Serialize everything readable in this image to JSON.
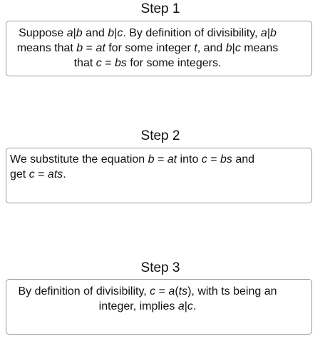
{
  "steps": [
    {
      "title": "Step 1",
      "lines": [
        [
          {
            "t": "Suppose "
          },
          {
            "t": "a",
            "i": true
          },
          {
            "t": "|"
          },
          {
            "t": "b",
            "i": true
          },
          {
            "t": " and "
          },
          {
            "t": "b",
            "i": true
          },
          {
            "t": "|"
          },
          {
            "t": "c",
            "i": true
          },
          {
            "t": ". By definition of divisibility, "
          },
          {
            "t": "a",
            "i": true
          },
          {
            "t": "|"
          },
          {
            "t": "b",
            "i": true
          }
        ],
        [
          {
            "t": "means that "
          },
          {
            "t": "b",
            "i": true
          },
          {
            "t": " = "
          },
          {
            "t": "at",
            "i": true
          },
          {
            "t": " for some integer "
          },
          {
            "t": "t",
            "i": true
          },
          {
            "t": ", and "
          },
          {
            "t": "b",
            "i": true
          },
          {
            "t": "|"
          },
          {
            "t": "c",
            "i": true
          },
          {
            "t": " means"
          }
        ],
        [
          {
            "t": "that "
          },
          {
            "t": "c",
            "i": true
          },
          {
            "t": " = "
          },
          {
            "t": "bs",
            "i": true
          },
          {
            "t": " for some integers."
          }
        ]
      ]
    },
    {
      "title": "Step 2",
      "lines": [
        [
          {
            "t": "We substitute the equation "
          },
          {
            "t": "b",
            "i": true
          },
          {
            "t": " = "
          },
          {
            "t": "at",
            "i": true
          },
          {
            "t": " into "
          },
          {
            "t": "c",
            "i": true
          },
          {
            "t": " = "
          },
          {
            "t": "bs",
            "i": true
          },
          {
            "t": " and"
          }
        ],
        [
          {
            "t": "get "
          },
          {
            "t": "c",
            "i": true
          },
          {
            "t": " = "
          },
          {
            "t": "ats",
            "i": true
          },
          {
            "t": "."
          }
        ]
      ]
    },
    {
      "title": "Step 3",
      "lines": [
        [
          {
            "t": "By definition of divisibility, "
          },
          {
            "t": "c",
            "i": true
          },
          {
            "t": " = "
          },
          {
            "t": "a",
            "i": true
          },
          {
            "t": "("
          },
          {
            "t": "ts",
            "i": true
          },
          {
            "t": "), with ts being an"
          }
        ],
        [
          {
            "t": "integer, implies "
          },
          {
            "t": "a",
            "i": true
          },
          {
            "t": "|"
          },
          {
            "t": "c",
            "i": true
          },
          {
            "t": "."
          }
        ]
      ]
    }
  ]
}
